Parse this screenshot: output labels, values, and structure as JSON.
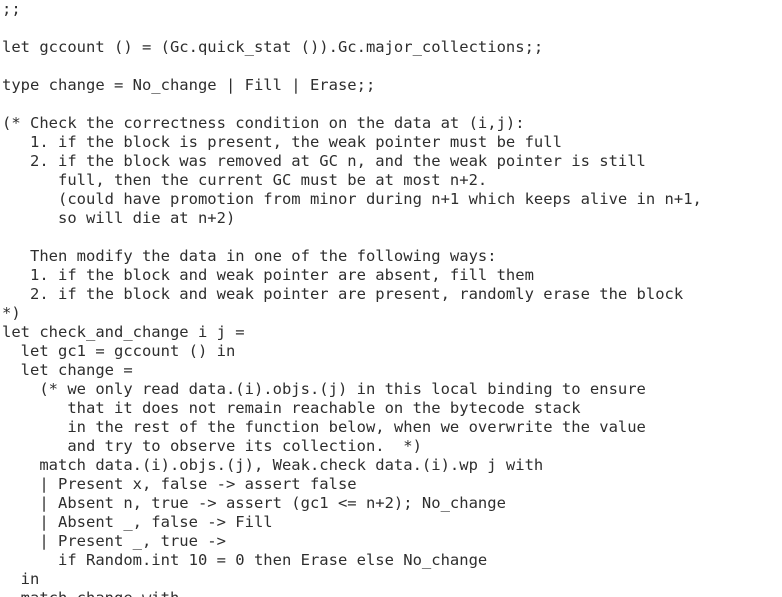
{
  "editor": {
    "lines": [
      ";;",
      "",
      "let gccount () = (Gc.quick_stat ()).Gc.major_collections;;",
      "",
      "type change = No_change | Fill | Erase;;",
      "",
      "(* Check the correctness condition on the data at (i,j):",
      "   1. if the block is present, the weak pointer must be full",
      "   2. if the block was removed at GC n, and the weak pointer is still",
      "      full, then the current GC must be at most n+2.",
      "      (could have promotion from minor during n+1 which keeps alive in n+1,",
      "      so will die at n+2)",
      "",
      "   Then modify the data in one of the following ways:",
      "   1. if the block and weak pointer are absent, fill them",
      "   2. if the block and weak pointer are present, randomly erase the block",
      "*)",
      "let check_and_change i j =",
      "  let gc1 = gccount () in",
      "  let change =",
      "    (* we only read data.(i).objs.(j) in this local binding to ensure",
      "       that it does not remain reachable on the bytecode stack",
      "       in the rest of the function below, when we overwrite the value",
      "       and try to observe its collection.  *)",
      "    match data.(i).objs.(j), Weak.check data.(i).wp j with",
      "    | Present x, false -> assert false",
      "    | Absent n, true -> assert (gc1 <= n+2); No_change",
      "    | Absent _, false -> Fill",
      "    | Present _, true ->",
      "      if Random.int 10 = 0 then Erase else No_change",
      "  in",
      "  match change with"
    ]
  }
}
